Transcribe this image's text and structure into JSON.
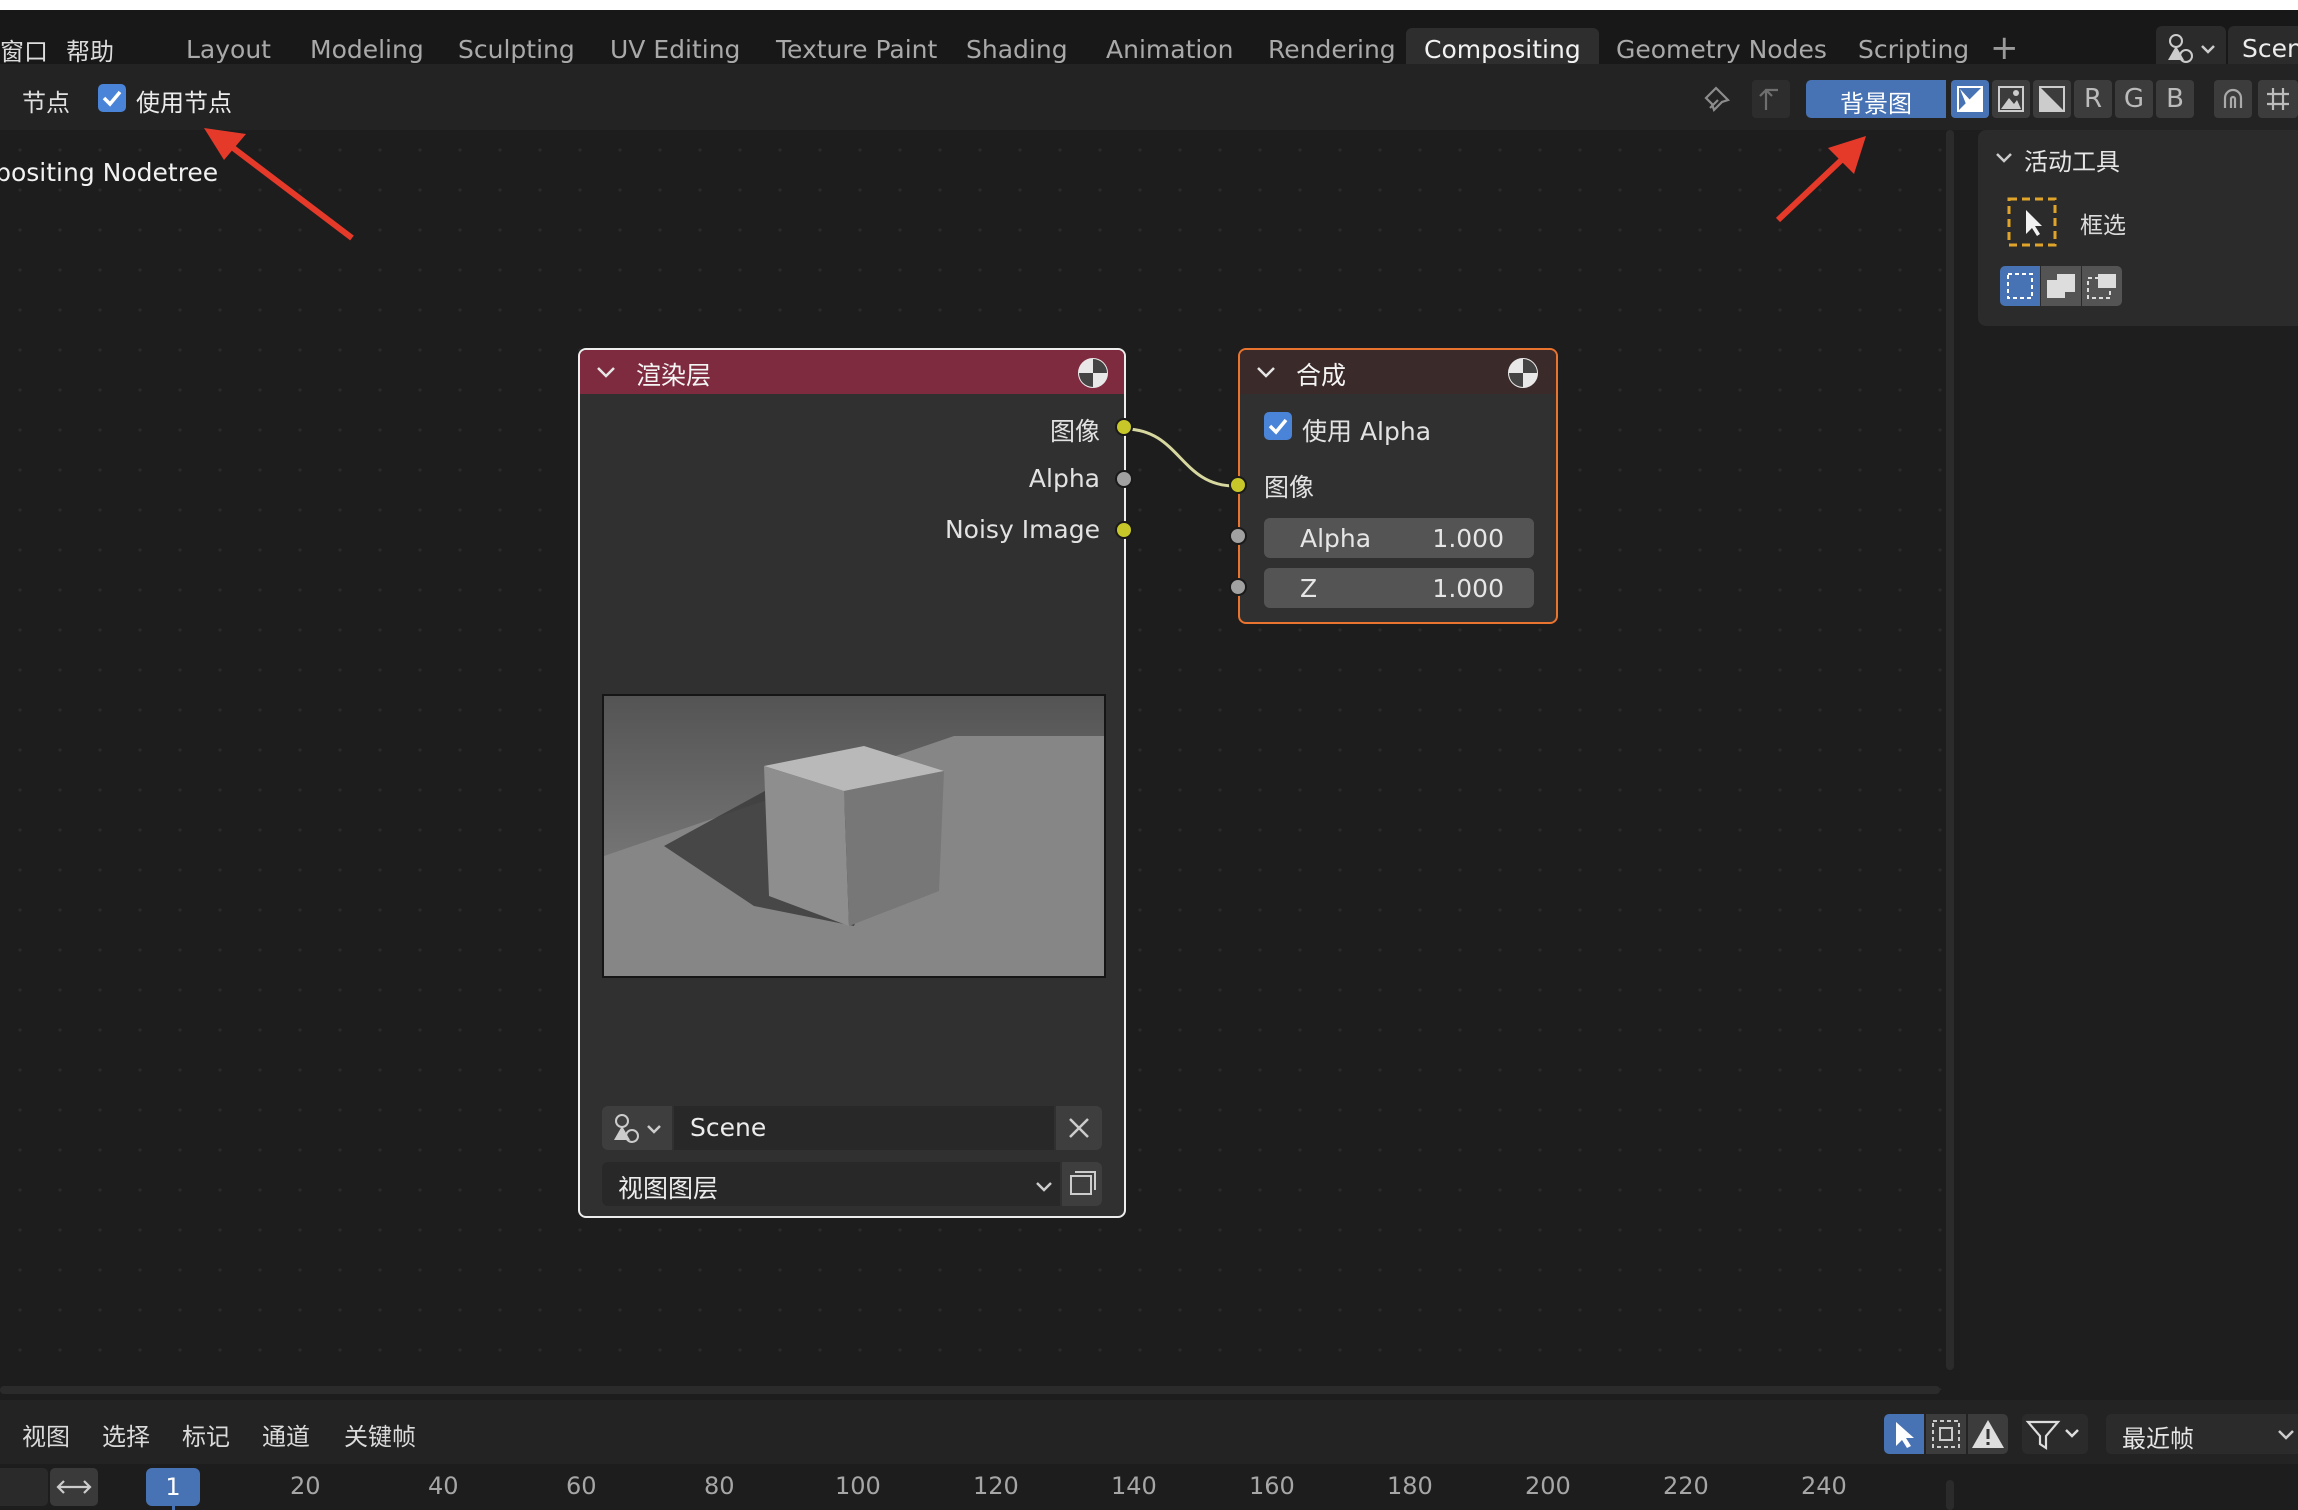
{
  "top_menu": {
    "window": "窗口",
    "help": "帮助"
  },
  "workspace_tabs": [
    {
      "label": "Layout"
    },
    {
      "label": "Modeling"
    },
    {
      "label": "Sculpting"
    },
    {
      "label": "UV Editing"
    },
    {
      "label": "Texture Paint"
    },
    {
      "label": "Shading"
    },
    {
      "label": "Animation"
    },
    {
      "label": "Rendering"
    },
    {
      "label": "Compositing",
      "active": true
    },
    {
      "label": "Geometry Nodes"
    },
    {
      "label": "Scripting"
    }
  ],
  "add_workspace_icon": "plus-icon",
  "scene_selector": {
    "label": "Scen",
    "icon": "scene-icon"
  },
  "editor_header": {
    "menu_node": "节点",
    "use_nodes_label": "使用节点",
    "use_nodes_checked": true,
    "backdrop_label": "背景图",
    "channel_r": "R",
    "channel_g": "G",
    "channel_b": "B",
    "icons": [
      "pin-icon",
      "parent-node-icon",
      "backdrop-color-alpha-icon",
      "backdrop-color-icon",
      "backdrop-alpha-icon",
      "snap-icon",
      "grid-icon"
    ]
  },
  "canvas": {
    "tree_name": "Compositing Nodetree"
  },
  "annotation_color": "#e53a2a",
  "render_layers_node": {
    "title": "渲染层",
    "header_color": "#7e2a3f",
    "outputs": [
      "图像",
      "Alpha",
      "Noisy Image"
    ],
    "scene_label": "Scene",
    "layer_label": "视图图层"
  },
  "composite_node": {
    "title": "合成",
    "header_color": "#3b2a2a",
    "outline_color": "#e9742f",
    "use_alpha_label": "使用 Alpha",
    "use_alpha_checked": true,
    "input_image": "图像",
    "alpha_label": "Alpha",
    "alpha_value": "1.000",
    "z_label": "Z",
    "z_value": "1.000"
  },
  "sidebar": {
    "panel_title": "活动工具",
    "tool_label": "框选",
    "mode_icons": [
      "select-new-icon",
      "select-extend-icon",
      "select-subtract-icon"
    ]
  },
  "timeline": {
    "menus": [
      "视图",
      "选择",
      "标记",
      "通道",
      "关键帧"
    ],
    "playback_label": "最近帧",
    "current_frame": "1",
    "frames": [
      "20",
      "40",
      "60",
      "80",
      "100",
      "120",
      "140",
      "160",
      "180",
      "200",
      "220",
      "240"
    ]
  }
}
